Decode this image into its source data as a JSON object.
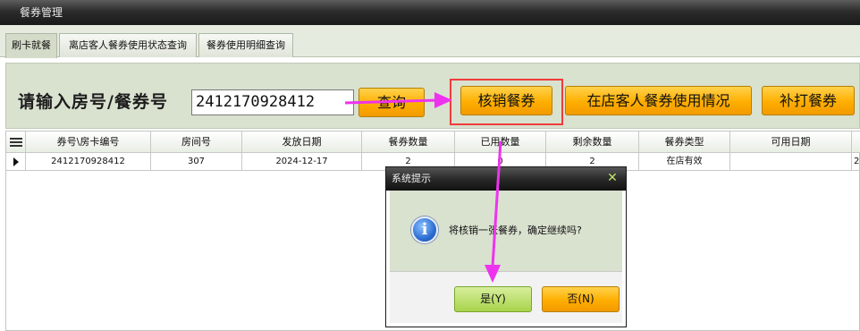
{
  "window": {
    "title": "餐券管理"
  },
  "tabs": [
    {
      "label": "刷卡就餐",
      "active": true
    },
    {
      "label": "离店客人餐券使用状态查询",
      "active": false
    },
    {
      "label": "餐券使用明细查询",
      "active": false
    }
  ],
  "search": {
    "label": "请输入房号/餐券号",
    "value": "2412170928412"
  },
  "buttons": {
    "query": "查询",
    "redeem": "核销餐券",
    "in_house_usage": "在店客人餐券使用情况",
    "reprint": "补打餐券"
  },
  "table": {
    "columns": [
      "券号\\房卡编号",
      "房间号",
      "发放日期",
      "餐券数量",
      "已用数量",
      "剩余数量",
      "餐券类型",
      "可用日期"
    ],
    "rows": [
      [
        "2412170928412",
        "307",
        "2024-12-17",
        "2",
        "0",
        "2",
        "在店有效",
        ""
      ]
    ],
    "extra_cell": "2"
  },
  "dialog": {
    "title": "系统提示",
    "close_glyph": "✕",
    "message": "将核销一张餐券，确定继续吗?",
    "yes_label": "是(Y)",
    "no_label": "否(N)"
  },
  "colors": {
    "annotation_arrow": "#ee33ee",
    "highlight_box": "#ef3c3c",
    "button_orange": "#ffae00"
  }
}
